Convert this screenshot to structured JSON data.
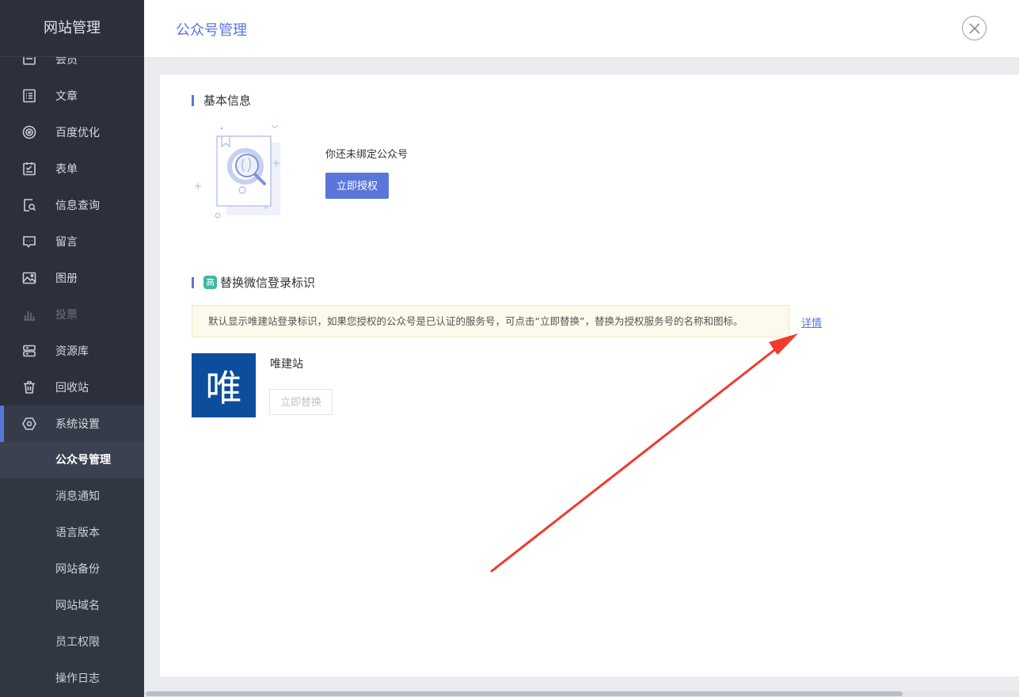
{
  "sidebar": {
    "title": "网站管理",
    "items": [
      {
        "label": "会员",
        "icon": "member-icon"
      },
      {
        "label": "文章",
        "icon": "article-icon"
      },
      {
        "label": "百度优化",
        "icon": "seo-icon"
      },
      {
        "label": "表单",
        "icon": "form-icon"
      },
      {
        "label": "信息查询",
        "icon": "query-icon"
      },
      {
        "label": "留言",
        "icon": "message-icon"
      },
      {
        "label": "图册",
        "icon": "gallery-icon"
      },
      {
        "label": "投票",
        "icon": "vote-icon"
      },
      {
        "label": "资源库",
        "icon": "resource-icon"
      },
      {
        "label": "回收站",
        "icon": "trash-icon"
      },
      {
        "label": "系统设置",
        "icon": "settings-icon"
      }
    ],
    "submenu": [
      {
        "label": "公众号管理"
      },
      {
        "label": "消息通知"
      },
      {
        "label": "语言版本"
      },
      {
        "label": "网站备份"
      },
      {
        "label": "网站域名"
      },
      {
        "label": "员工权限"
      },
      {
        "label": "操作日志"
      }
    ]
  },
  "header": {
    "title": "公众号管理"
  },
  "basic_info": {
    "title": "基本信息",
    "unbound_text": "你还未绑定公众号",
    "authorize_button": "立即授权"
  },
  "login_mark": {
    "badge": "高",
    "title": "替换微信登录标识",
    "notice": "默认显示唯建站登录标识，如果您授权的公众号是已认证的服务号，可点击“立即替换”，替换为授权服务号的名称和图标。",
    "detail_link": "详情",
    "logo_char": "唯",
    "site_name": "唯建站",
    "replace_button": "立即替换"
  },
  "colors": {
    "accent": "#5a76d9",
    "sidebar_bg": "#2b303b",
    "logo_bg": "#0c4e9c",
    "annotation_arrow": "#f03a2e"
  }
}
